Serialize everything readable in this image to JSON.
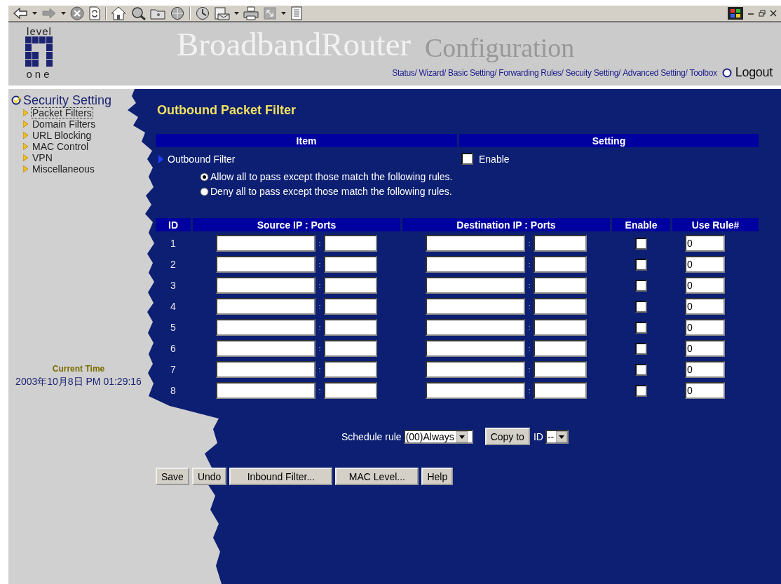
{
  "header": {
    "logo_top": "level",
    "logo_bottom": "one",
    "title": "BroadbandRouter",
    "subtitle": "Configuration",
    "nav": [
      "Status/",
      "Wizard/",
      "Basic Setting/",
      "Forwarding Rules/",
      "Secuity Setting/",
      "Advanced Setting/",
      "Toolbox"
    ],
    "logout": "Logout"
  },
  "sidebar": {
    "title": "Security Setting",
    "items": [
      {
        "label": "Packet Filters",
        "selected": true
      },
      {
        "label": "Domain Filters",
        "selected": false
      },
      {
        "label": "URL Blocking",
        "selected": false
      },
      {
        "label": "MAC Control",
        "selected": false
      },
      {
        "label": "VPN",
        "selected": false
      },
      {
        "label": "Miscellaneous",
        "selected": false
      }
    ],
    "current_time_label": "Current Time",
    "current_time": "2003年10月8日 PM 01:29:16"
  },
  "main": {
    "title": "Outbound Packet Filter",
    "settings_columns": [
      "Item",
      "Setting"
    ],
    "filter_label": "Outbound Filter",
    "enable_label": "Enable",
    "enable_checked": false,
    "policies": [
      {
        "label": "Allow all to pass except those match the following rules.",
        "selected": true
      },
      {
        "label": "Deny all to pass except those match the following rules.",
        "selected": false
      }
    ],
    "rules_columns": [
      "ID",
      "Source IP : Ports",
      "Destination IP : Ports",
      "Enable",
      "Use Rule#"
    ],
    "rules": [
      {
        "id": "1",
        "source_separator": ":",
        "destination_separator": ":",
        "enabled": false,
        "use_rule": "0"
      },
      {
        "id": "2",
        "source_separator": ":",
        "destination_separator": ":",
        "enabled": false,
        "use_rule": "0"
      },
      {
        "id": "3",
        "source_separator": ":",
        "destination_separator": ":",
        "enabled": false,
        "use_rule": "0"
      },
      {
        "id": "4",
        "source_separator": ":",
        "destination_separator": ":",
        "enabled": false,
        "use_rule": "0"
      },
      {
        "id": "5",
        "source_separator": ":",
        "destination_separator": ":",
        "enabled": false,
        "use_rule": "0"
      },
      {
        "id": "6",
        "source_separator": ":",
        "destination_separator": ":",
        "enabled": false,
        "use_rule": "0"
      },
      {
        "id": "7",
        "source_separator": ":",
        "destination_separator": ":",
        "enabled": false,
        "use_rule": "0"
      },
      {
        "id": "8",
        "source_separator": ":",
        "destination_separator": ":",
        "enabled": false,
        "use_rule": "0"
      }
    ],
    "schedule_label": "Schedule rule",
    "schedule_value": "(00)Always",
    "copy_button": "Copy to",
    "id_label": "ID",
    "id_value": "--",
    "buttons": [
      "Save",
      "Undo",
      "Inbound Filter...",
      "MAC Level...",
      "Help"
    ]
  }
}
